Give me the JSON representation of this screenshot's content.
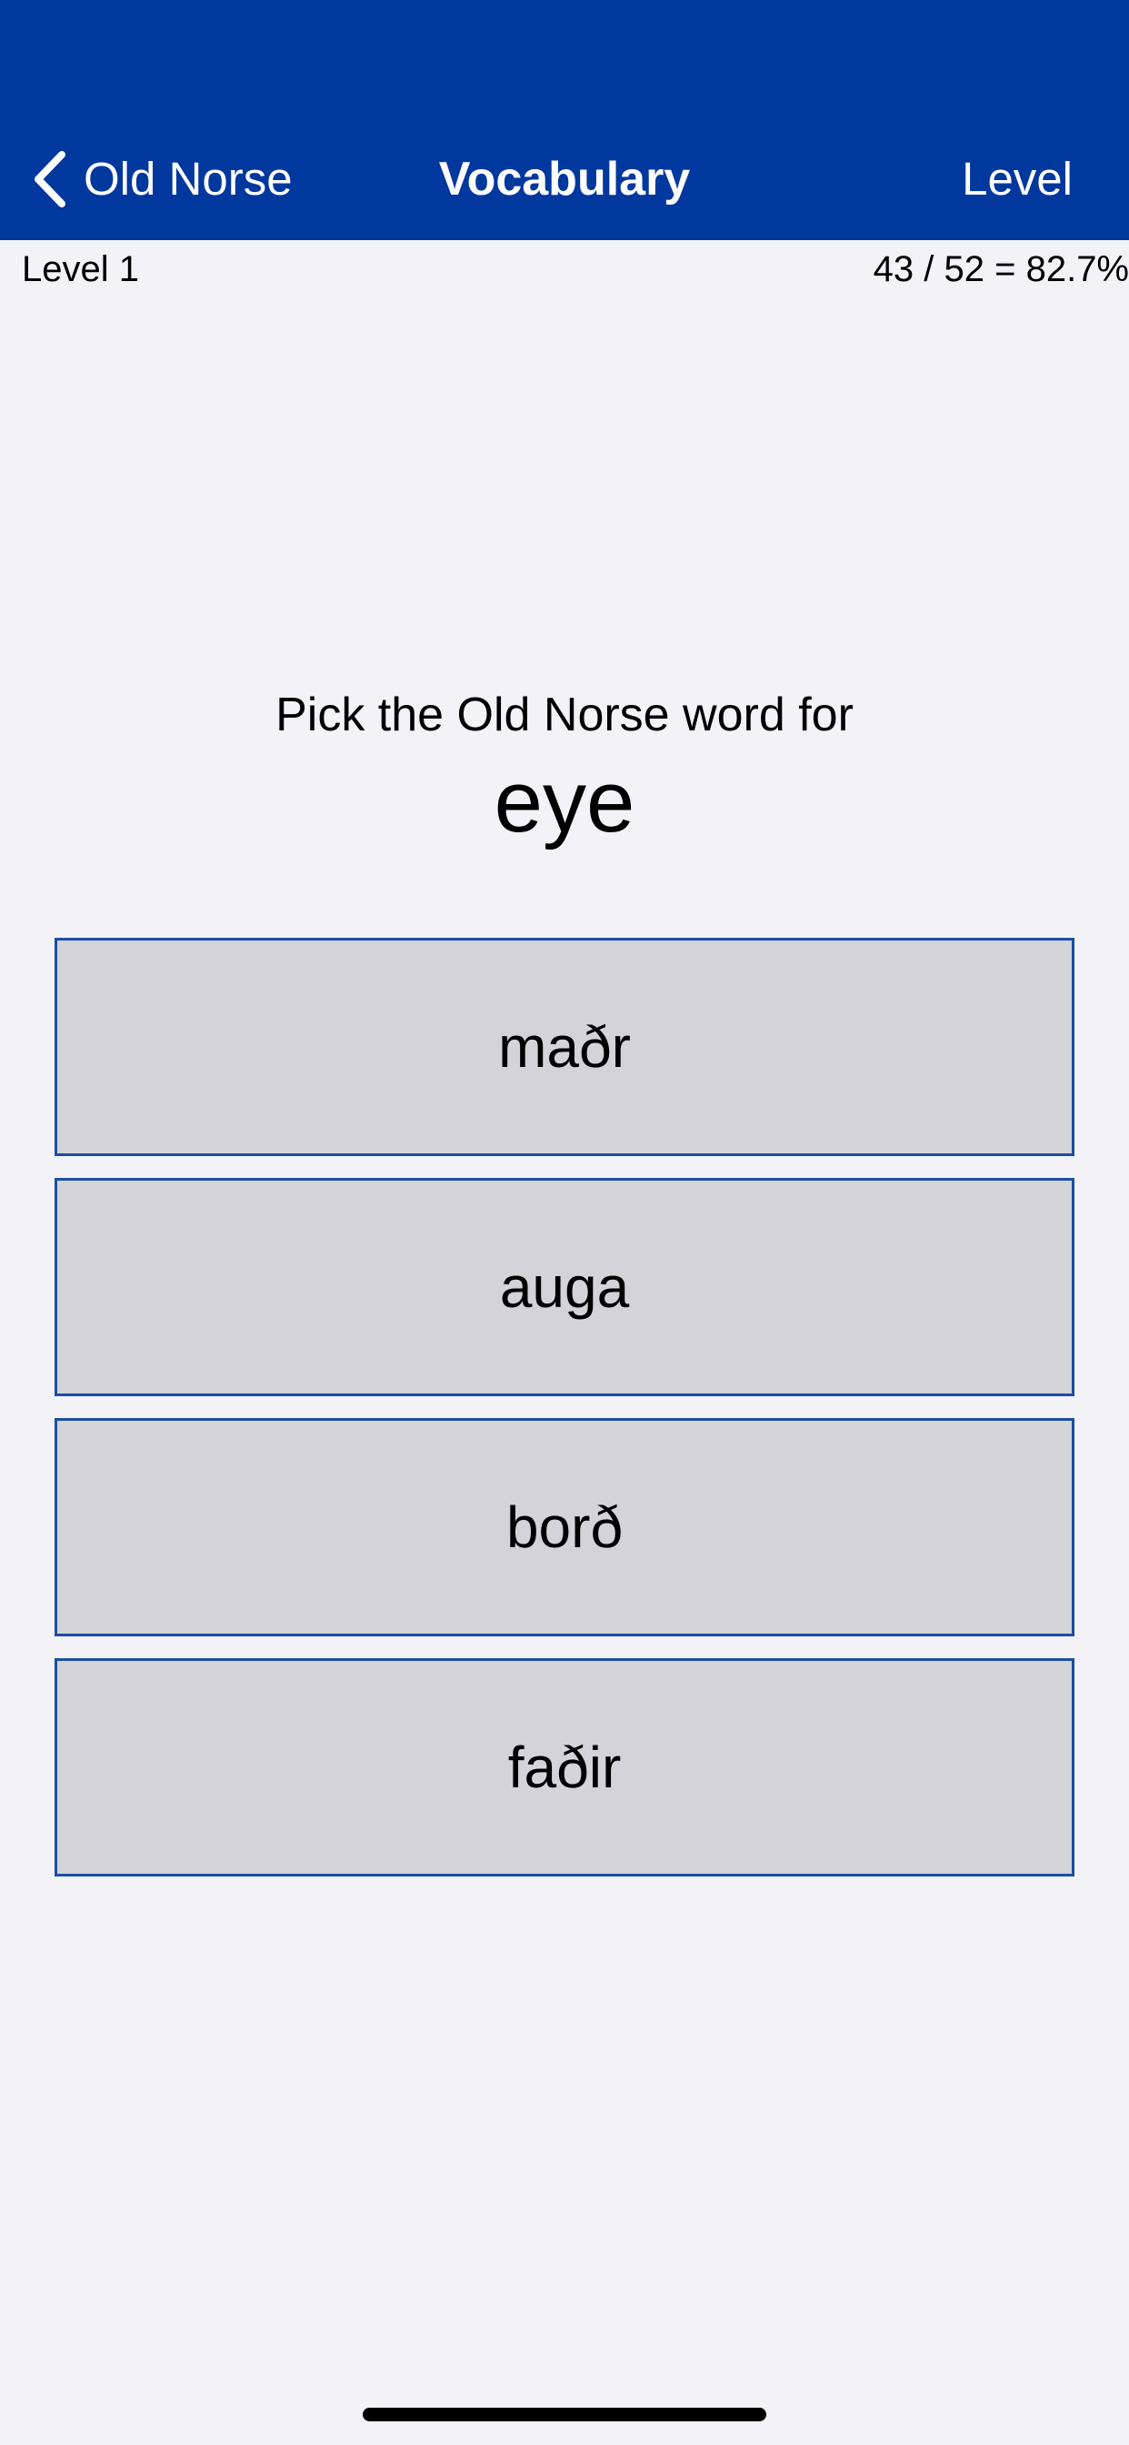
{
  "navbar": {
    "back_label": "Old Norse",
    "title": "Vocabulary",
    "right_label": "Level",
    "background_color": "#00389e",
    "back_icon": "chevron-left-icon"
  },
  "status": {
    "level": "Level 1",
    "score": "43 / 52 = 82.7%"
  },
  "quiz": {
    "prompt": "Pick the Old Norse word for",
    "word": "eye",
    "options": [
      {
        "label": "maðr"
      },
      {
        "label": "auga"
      },
      {
        "label": "borð"
      },
      {
        "label": "faðir"
      }
    ]
  }
}
